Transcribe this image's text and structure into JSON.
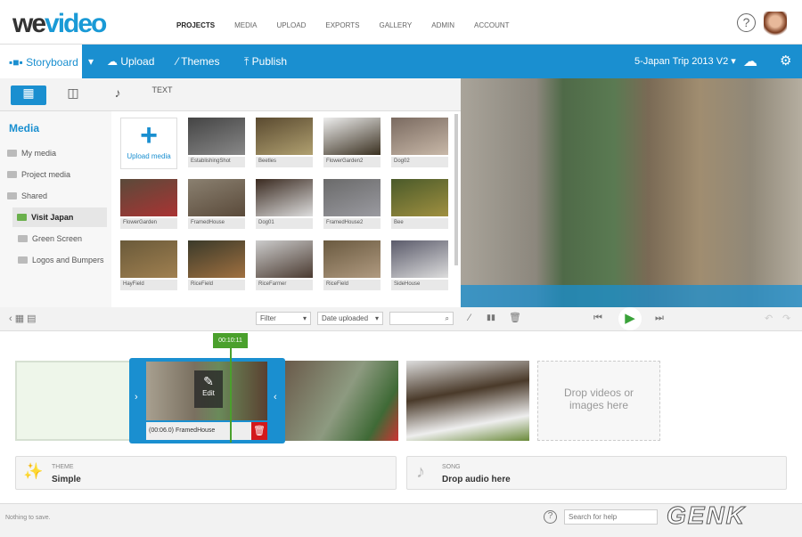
{
  "header": {
    "logo": "WeVideo",
    "nav": [
      "PROJECTS",
      "MEDIA",
      "UPLOAD",
      "EXPORTS",
      "GALLERY",
      "ADMIN",
      "ACCOUNT"
    ],
    "help": "?"
  },
  "toolbar": {
    "storyboard": "Storyboard",
    "upload": "Upload",
    "themes": "Themes",
    "publish": "Publish",
    "project": "5-Japan Trip 2013 V2 ▾",
    "accent": "#1a8fd0"
  },
  "media": {
    "title": "Media",
    "items": [
      "My media",
      "Project media",
      "Shared",
      "Visit Japan",
      "Green Screen",
      "Logos and Bumpers"
    ],
    "upload_label": "Upload media",
    "thumbs": [
      "EstablishingShot",
      "Beetles",
      "FlowerGarden2",
      "Dog02",
      "FlowerGarden",
      "FramedHouse",
      "Dog01",
      "FramedHouse2",
      "Bee",
      "HayField",
      "RiceField",
      "RiceFarmer",
      "RiceField",
      "SideHouse"
    ]
  },
  "controls": {
    "filter": "Filter",
    "sort": "Date uploaded",
    "search_placeholder": ""
  },
  "timeline": {
    "time": "00:10:11",
    "edit": "Edit",
    "clip_label": "(00:06.0) FramedHouse",
    "drop_text": "Drop videos or images here"
  },
  "theme": {
    "label": "THEME",
    "value": "Simple"
  },
  "song": {
    "label": "SONG",
    "value": "Drop audio here"
  },
  "status": {
    "text": "Nothing to save.",
    "help_placeholder": "Search for help",
    "watermark": "GENK"
  }
}
